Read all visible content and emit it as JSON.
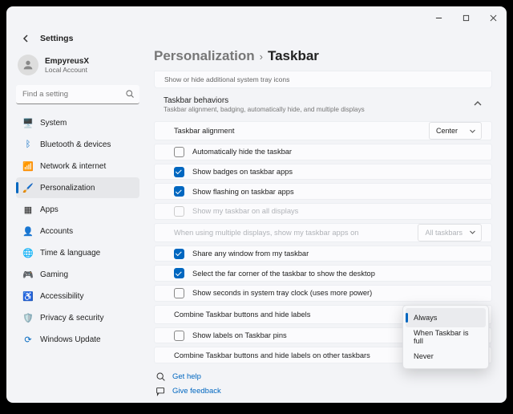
{
  "app_title": "Settings",
  "account": {
    "name": "EmpyreusX",
    "type": "Local Account"
  },
  "search_placeholder": "Find a setting",
  "nav": [
    {
      "label": "System"
    },
    {
      "label": "Bluetooth & devices"
    },
    {
      "label": "Network & internet"
    },
    {
      "label": "Personalization"
    },
    {
      "label": "Apps"
    },
    {
      "label": "Accounts"
    },
    {
      "label": "Time & language"
    },
    {
      "label": "Gaming"
    },
    {
      "label": "Accessibility"
    },
    {
      "label": "Privacy & security"
    },
    {
      "label": "Windows Update"
    }
  ],
  "breadcrumb": {
    "parent": "Personalization",
    "current": "Taskbar"
  },
  "tray_hint": "Show or hide additional system tray icons",
  "behaviors": {
    "title": "Taskbar behaviors",
    "subtitle": "Taskbar alignment, badging, automatically hide, and multiple displays"
  },
  "rows": {
    "alignment_label": "Taskbar alignment",
    "alignment_value": "Center",
    "autohide": "Automatically hide the taskbar",
    "badges": "Show badges on taskbar apps",
    "flashing": "Show flashing on taskbar apps",
    "multidisplay": "Show my taskbar on all displays",
    "multi_where_label": "When using multiple displays, show my taskbar apps on",
    "multi_where_value": "All taskbars",
    "share": "Share any window from my taskbar",
    "farcorner": "Select the far corner of the taskbar to show the desktop",
    "seconds": "Show seconds in system tray clock (uses more power)",
    "combine_label": "Combine Taskbar buttons and hide labels",
    "combine_value": "Always",
    "pin_labels": "Show labels on Taskbar pins",
    "combine_other_label": "Combine Taskbar buttons and hide labels on other taskbars"
  },
  "dropdown": {
    "opt1": "Always",
    "opt2": "When Taskbar is full",
    "opt3": "Never"
  },
  "footer": {
    "help": "Get help",
    "feedback": "Give feedback"
  }
}
